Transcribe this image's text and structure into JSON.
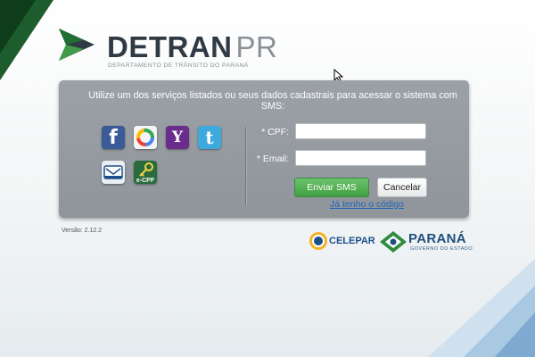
{
  "brand": {
    "name": "DETRAN",
    "suffix": "PR",
    "subtitle": "DEPARTAMENTO DE TRÂNSITO DO PARANÁ"
  },
  "login": {
    "instructions": "Utilize um dos serviços listados ou seus dados cadastrais para acessar o sistema com SMS:",
    "services": [
      {
        "name": "facebook",
        "icon": "facebook-icon",
        "glyph": "f"
      },
      {
        "name": "google",
        "icon": "google-icon"
      },
      {
        "name": "yahoo",
        "icon": "yahoo-icon",
        "glyph": "Y"
      },
      {
        "name": "twitter",
        "icon": "twitter-icon",
        "glyph": "t"
      },
      {
        "name": "e-cnpj",
        "icon": "certificate-card-icon"
      },
      {
        "name": "e-cpf",
        "icon": "ecpf-key-icon",
        "label": "e-CPF"
      }
    ],
    "cpf_label": "* CPF:",
    "cpf_value": "",
    "email_label": "* Email:",
    "email_value": "",
    "send_button": "Enviar SMS",
    "cancel_button": "Cancelar",
    "have_code_link": "Já tenho o código"
  },
  "version": "Versão: 2.12.2",
  "footer": {
    "celepar": "CELEPAR",
    "parana": "PARANÁ",
    "parana_sub": "GOVERNO DO ESTADO"
  },
  "colors": {
    "panel": "#979da2",
    "send_button": "#52ab52",
    "link": "#1c65b9",
    "brand_dark": "#2f3a44",
    "brand_green": "#1f6f35"
  }
}
